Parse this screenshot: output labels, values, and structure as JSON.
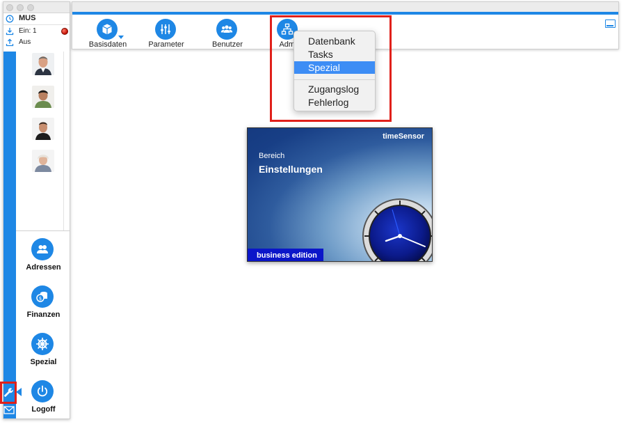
{
  "left_panel": {
    "user_code": "MUS",
    "checkin_label": "Ein: 1",
    "checkout_label": "Aus",
    "nav": [
      {
        "label": "Adressen",
        "icon": "people-icon"
      },
      {
        "label": "Finanzen",
        "icon": "coins-icon"
      },
      {
        "label": "Spezial",
        "icon": "ship-wheel-icon"
      },
      {
        "label": "Logoff",
        "icon": "power-icon"
      }
    ]
  },
  "toolbar": {
    "buttons": [
      {
        "label": "Basisdaten",
        "icon": "cube-icon"
      },
      {
        "label": "Parameter",
        "icon": "sliders-icon"
      },
      {
        "label": "Benutzer",
        "icon": "users-icon"
      },
      {
        "label": "Admi",
        "icon": "hierarchy-icon"
      }
    ]
  },
  "admin_menu": {
    "items": [
      "Datenbank",
      "Tasks",
      "Spezial",
      "Zugangslog",
      "Fehlerlog"
    ],
    "selected": "Spezial"
  },
  "splash": {
    "brand": "timeSensor",
    "section_label": "Bereich",
    "title": "Einstellungen",
    "edition": "business edition"
  },
  "colors": {
    "accent": "#1e87e5",
    "highlight": "#e0201a",
    "menu_selection": "#3d8df5"
  }
}
